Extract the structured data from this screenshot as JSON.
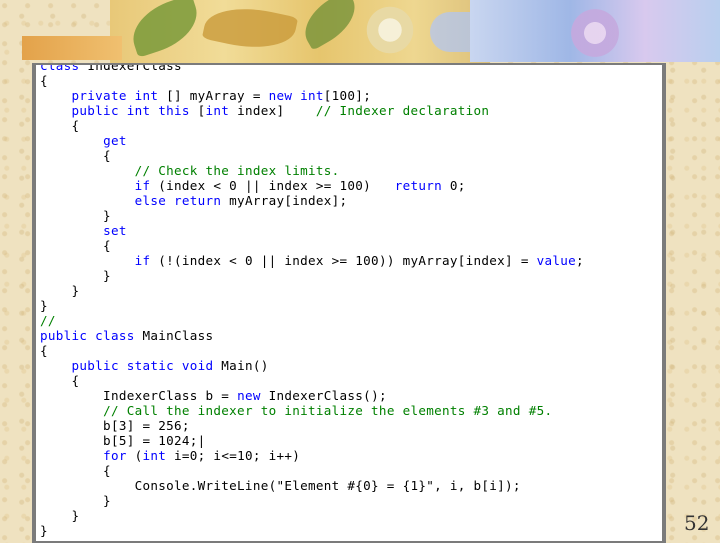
{
  "slide": {
    "page_number": "52"
  },
  "code": {
    "lines": [
      "class IndexerClass",
      "{",
      "    private int [] myArray = new int[100];",
      "    public int this [int index]    // Indexer declaration",
      "    {",
      "        get",
      "        {",
      "            // Check the index limits.",
      "            if (index < 0 || index >= 100)   return 0;",
      "            else return myArray[index];",
      "        }",
      "        set",
      "        {",
      "            if (!(index < 0 || index >= 100)) myArray[index] = value;",
      "        }",
      "    }",
      "}",
      "//",
      "public class MainClass",
      "{",
      "    public static void Main()",
      "    {",
      "        IndexerClass b = new IndexerClass();",
      "        // Call the indexer to initialize the elements #3 and #5.",
      "        b[3] = 256;",
      "        b[5] = 1024;|",
      "        for (int i=0; i<=10; i++)",
      "        {",
      "            Console.WriteLine(\"Element #{0} = {1}\", i, b[i]);",
      "        }",
      "    }",
      "}"
    ]
  }
}
